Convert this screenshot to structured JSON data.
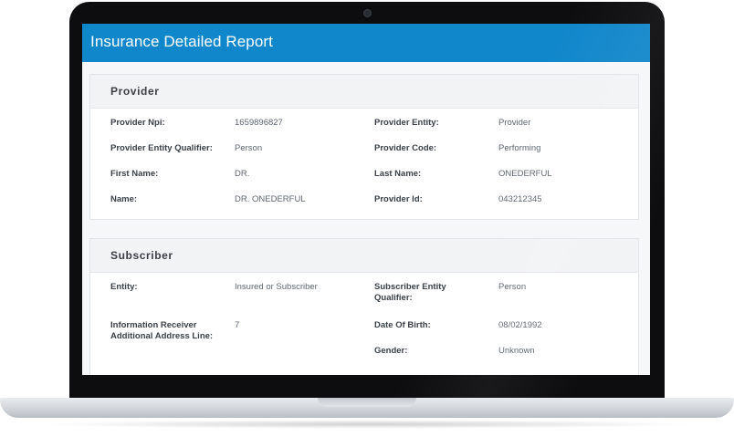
{
  "app": {
    "title": "Insurance Detailed Report"
  },
  "provider": {
    "title": "Provider",
    "fields": [
      {
        "label": "Provider Npi:",
        "value": "1659896827"
      },
      {
        "label": "Provider Entity:",
        "value": "Provider"
      },
      {
        "label": "Provider Entity Qualifier:",
        "value": "Person"
      },
      {
        "label": "Provider Code:",
        "value": "Performing"
      },
      {
        "label": "First Name:",
        "value": "DR."
      },
      {
        "label": "Last Name:",
        "value": "ONEDERFUL"
      },
      {
        "label": "Name:",
        "value": "DR. ONEDERFUL"
      },
      {
        "label": "Provider Id:",
        "value": "043212345"
      }
    ]
  },
  "subscriber": {
    "title": "Subscriber",
    "fields": [
      {
        "label": "Entity:",
        "value": "Insured or Subscriber"
      },
      {
        "label": "Subscriber Entity Qualifier:",
        "value": "Person"
      },
      {
        "label": "Information Receiver Additional Address Line:",
        "value": "7"
      },
      {
        "label": "Date Of Birth:",
        "value": "08/02/1992"
      },
      {
        "label": "Gender:",
        "value": "Unknown"
      }
    ]
  },
  "colors": {
    "header_blue": "#1187cb",
    "card_header_bg": "#f2f3f5",
    "bezel": "#0d0d0f"
  }
}
